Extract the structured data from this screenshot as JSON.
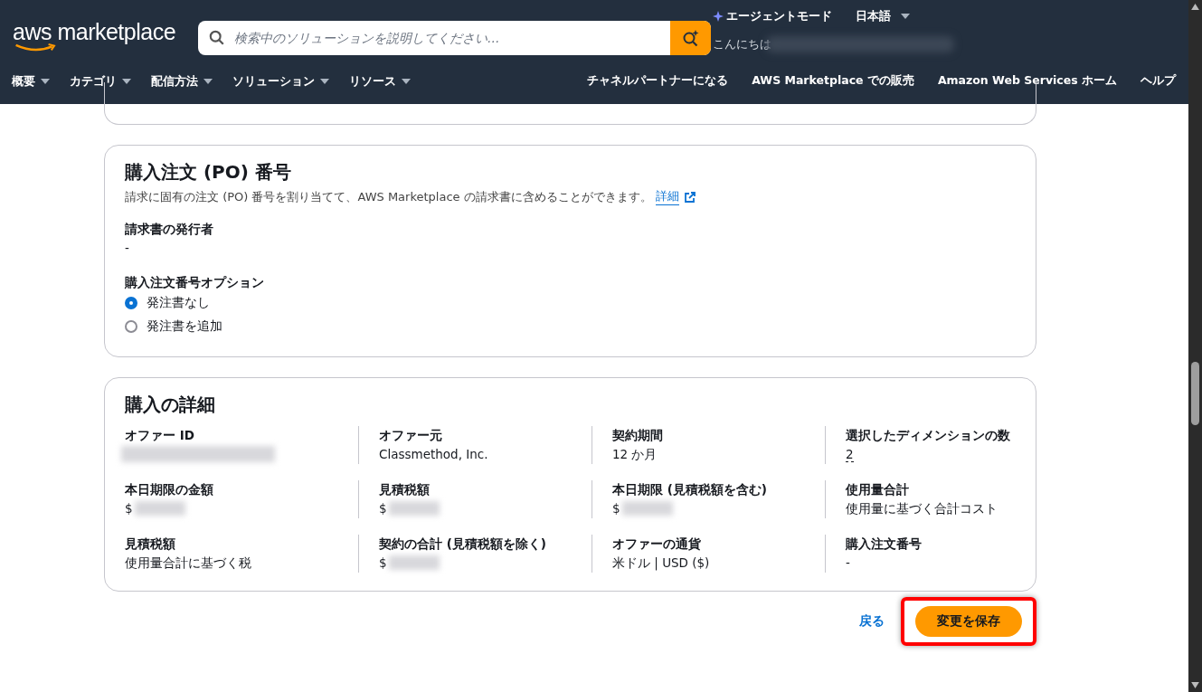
{
  "header": {
    "logo": "aws marketplace",
    "search_placeholder": "検索中のソリューションを説明してください...",
    "agent_mode": "エージェントモード",
    "language": "日本語",
    "greeting": "こんにちは",
    "greeting_redacted": true,
    "nav": [
      "概要",
      "カテゴリ",
      "配信方法",
      "ソリューション",
      "リソース"
    ],
    "links": [
      "チャネルパートナーになる",
      "AWS Marketplace での販売",
      "Amazon Web Services ホーム",
      "ヘルプ"
    ]
  },
  "po_section": {
    "title": "購入注文 (PO) 番号",
    "description": "請求に固有の注文 (PO) 番号を割り当てて、AWS Marketplace の請求書に含めることができます。",
    "link": "詳細",
    "issuer_label": "請求書の発行者",
    "issuer_value": "-",
    "option_label": "購入注文番号オプション",
    "options": [
      {
        "label": "発注書なし",
        "selected": true
      },
      {
        "label": "発注書を追加",
        "selected": false
      }
    ]
  },
  "details": {
    "title": "購入の詳細",
    "items": [
      {
        "label": "オファー ID",
        "value": "",
        "redacted": true
      },
      {
        "label": "オファー元",
        "value": "Classmethod, Inc.",
        "redacted": false
      },
      {
        "label": "契約期間",
        "value": "12 か月",
        "redacted": false
      },
      {
        "label": "選択したディメンションの数",
        "value": "2",
        "redacted": false,
        "kind": "popover"
      },
      {
        "label": "本日期限の金額",
        "value": "$",
        "redacted": true
      },
      {
        "label": "見積税額",
        "value": "$",
        "redacted": true
      },
      {
        "label": "本日期限 (見積税額を含む)",
        "value": "$",
        "redacted": true
      },
      {
        "label": "使用量合計",
        "value": "使用量に基づく合計コスト",
        "redacted": false
      },
      {
        "label": "見積税額",
        "value": "使用量合計に基づく税",
        "redacted": false
      },
      {
        "label": "契約の合計 (見積税額を除く)",
        "value": "$",
        "redacted": true
      },
      {
        "label": "オファーの通貨",
        "value": "米ドル | USD ($)",
        "redacted": false
      },
      {
        "label": "購入注文番号",
        "value": "-",
        "redacted": false
      }
    ]
  },
  "actions": {
    "back": "戻る",
    "save": "変更を保存",
    "save_highlighted": true
  }
}
